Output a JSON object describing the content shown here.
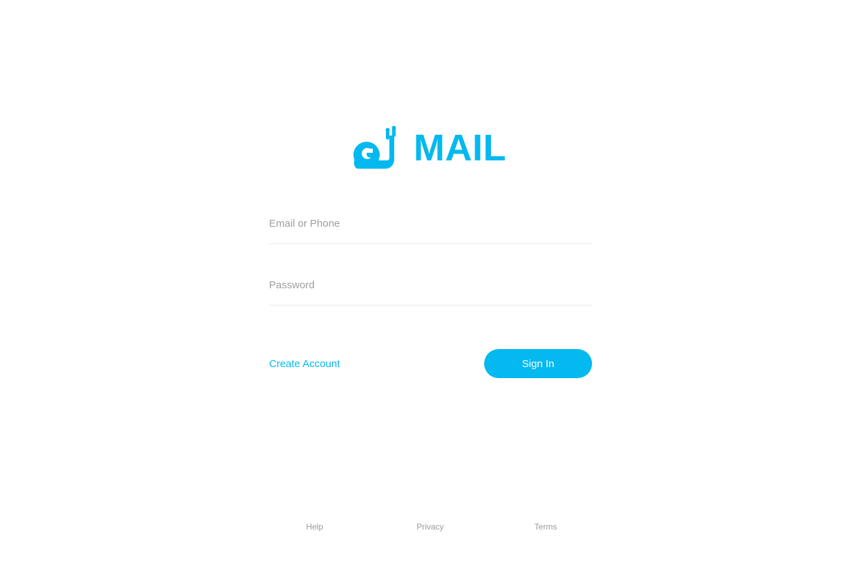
{
  "theme": {
    "accent": "#03b9ef"
  },
  "brand": {
    "name": "MAIL",
    "logo_icon": "snail-icon"
  },
  "form": {
    "email_placeholder": "Email or Phone",
    "email_value": "",
    "password_placeholder": "Password",
    "password_value": ""
  },
  "actions": {
    "create_account_label": "Create Account",
    "sign_in_label": "Sign In"
  },
  "footer": {
    "links": [
      {
        "label": "Help"
      },
      {
        "label": "Privacy"
      },
      {
        "label": "Terms"
      }
    ]
  }
}
